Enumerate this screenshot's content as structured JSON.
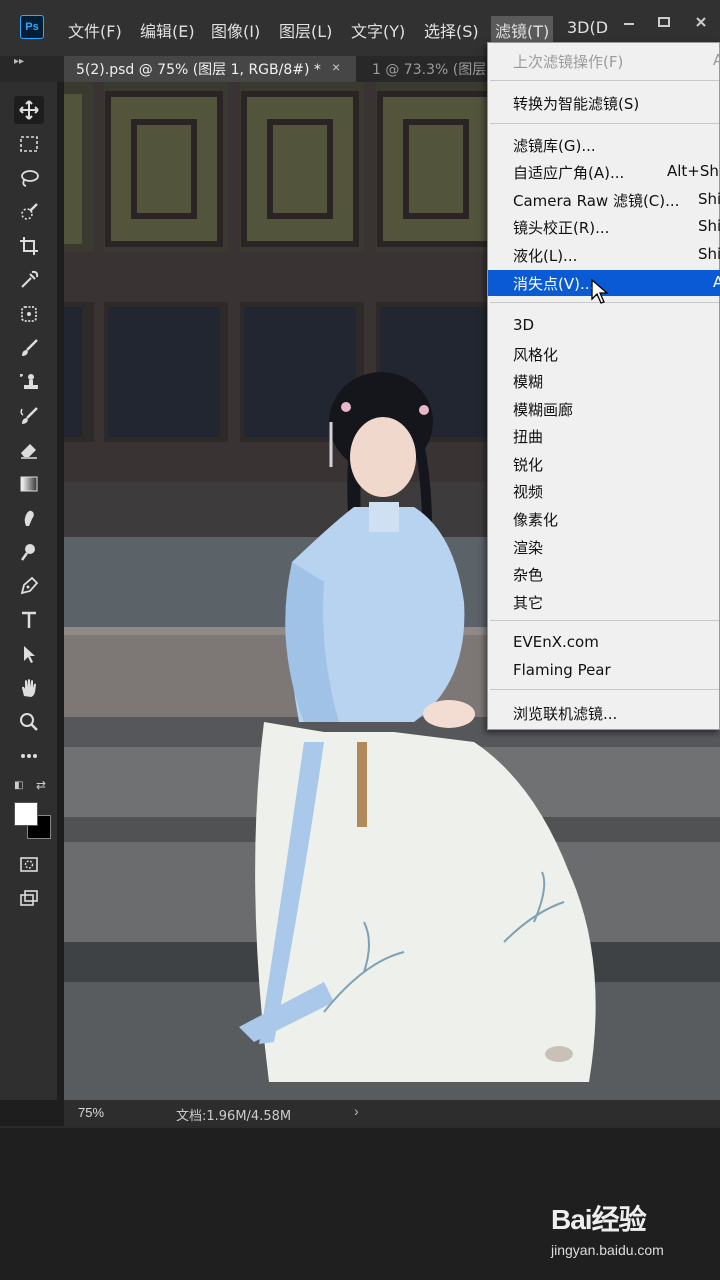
{
  "app": {
    "logo": "Ps"
  },
  "menubar": {
    "items": [
      "文件(F)",
      "编辑(E)",
      "图像(I)",
      "图层(L)",
      "文字(Y)",
      "选择(S)",
      "滤镜(T)",
      "3D(D"
    ],
    "active_item": "滤镜(T)",
    "window_controls": [
      "minimize-icon",
      "maximize-icon",
      "close-icon"
    ]
  },
  "tabs": {
    "active": "5(2).psd @ 75% (图层 1, RGB/8#) *",
    "close_glyph": "×",
    "inactive": "1 @ 73.3% (图层"
  },
  "toolbar": {
    "tools": [
      "move-icon",
      "marquee-icon",
      "lasso-icon",
      "quick-selection-icon",
      "crop-icon",
      "eyedropper-icon",
      "healing-brush-icon",
      "brush-icon",
      "clone-stamp-icon",
      "history-brush-icon",
      "eraser-icon",
      "gradient-icon",
      "smudge-icon",
      "dodge-icon",
      "pen-icon",
      "type-icon",
      "path-selection-icon",
      "hand-icon",
      "zoom-icon",
      "more-tools-icon"
    ],
    "selected_tool": "move-icon",
    "foreground_color": "#ffffff",
    "background_color": "#000000"
  },
  "statusbar": {
    "zoom": "75%",
    "doc_info": "文档:1.96M/4.58M",
    "arrow": "›"
  },
  "filter_menu": {
    "items": [
      {
        "label": "上次滤镜操作(F)",
        "shortcut": "A",
        "state": "disabled"
      },
      {
        "label": "转换为智能滤镜(S)",
        "shortcut": "",
        "state": "normal"
      },
      {
        "label": "滤镜库(G)...",
        "shortcut": "",
        "state": "normal"
      },
      {
        "label": "自适应广角(A)...",
        "shortcut": "Alt+Shi",
        "state": "normal"
      },
      {
        "label": "Camera Raw 滤镜(C)...",
        "shortcut": "Shi",
        "state": "normal"
      },
      {
        "label": "镜头校正(R)...",
        "shortcut": "Shi",
        "state": "normal"
      },
      {
        "label": "液化(L)...",
        "shortcut": "Shi",
        "state": "normal"
      },
      {
        "label": "消失点(V)...",
        "shortcut": "A",
        "state": "highlighted"
      },
      {
        "label": "3D",
        "shortcut": "",
        "state": "normal"
      },
      {
        "label": "风格化",
        "shortcut": "",
        "state": "normal"
      },
      {
        "label": "模糊",
        "shortcut": "",
        "state": "normal"
      },
      {
        "label": "模糊画廊",
        "shortcut": "",
        "state": "normal"
      },
      {
        "label": "扭曲",
        "shortcut": "",
        "state": "normal"
      },
      {
        "label": "锐化",
        "shortcut": "",
        "state": "normal"
      },
      {
        "label": "视频",
        "shortcut": "",
        "state": "normal"
      },
      {
        "label": "像素化",
        "shortcut": "",
        "state": "normal"
      },
      {
        "label": "渲染",
        "shortcut": "",
        "state": "normal"
      },
      {
        "label": "杂色",
        "shortcut": "",
        "state": "normal"
      },
      {
        "label": "其它",
        "shortcut": "",
        "state": "normal"
      },
      {
        "label": "EVEnX.com",
        "shortcut": "",
        "state": "normal"
      },
      {
        "label": "Flaming Pear",
        "shortcut": "",
        "state": "normal"
      },
      {
        "label": "浏览联机滤镜...",
        "shortcut": "",
        "state": "normal"
      }
    ],
    "highlight_color": "#0a5ad6"
  },
  "watermark": {
    "logo": "Bai经验",
    "url": "jingyan.baidu.com"
  }
}
